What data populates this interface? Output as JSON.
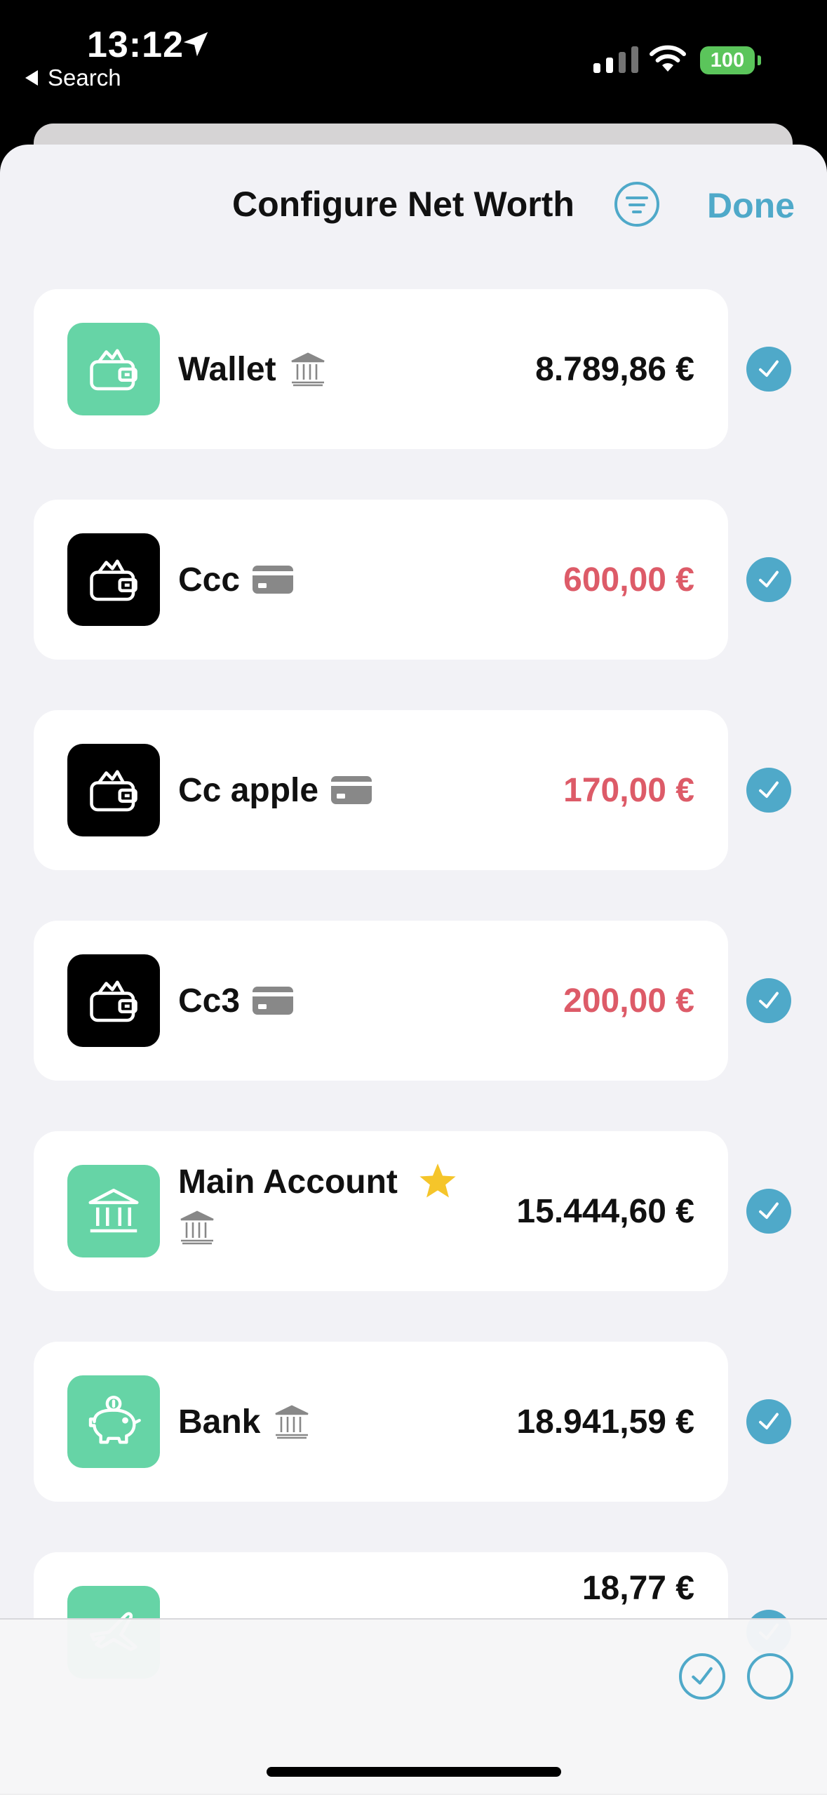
{
  "status_bar": {
    "time": "13:12",
    "back_label": "Search",
    "battery": "100"
  },
  "header": {
    "title": "Configure Net Worth",
    "done_label": "Done"
  },
  "colors": {
    "accent": "#4fa9c9",
    "negative": "#dd5b68",
    "icon_green": "#66d4a6",
    "star": "#f5c52a"
  },
  "accounts": [
    {
      "name": "Wallet",
      "type_icon": "bank-icon",
      "account_icon": "wallet-icon",
      "amount": "8.789,86 €",
      "negative": false,
      "selected": true
    },
    {
      "name": "Ccc",
      "type_icon": "credit-card-icon",
      "account_icon": "wallet-icon",
      "amount": "600,00 €",
      "negative": true,
      "selected": true
    },
    {
      "name": "Cc apple",
      "type_icon": "credit-card-icon",
      "account_icon": "wallet-icon",
      "amount": "170,00 €",
      "negative": true,
      "selected": true
    },
    {
      "name": "Cc3",
      "type_icon": "credit-card-icon",
      "account_icon": "wallet-icon",
      "amount": "200,00 €",
      "negative": true,
      "selected": true
    },
    {
      "name": "Main Account",
      "type_icon": "bank-icon",
      "account_icon": "bank-building-icon",
      "amount": "15.444,60 €",
      "negative": false,
      "favorite": true,
      "selected": true
    },
    {
      "name": "Bank",
      "type_icon": "bank-icon",
      "account_icon": "piggy-bank-icon",
      "amount": "18.941,59 €",
      "negative": false,
      "selected": true
    },
    {
      "name": "",
      "type_icon": "bank-icon",
      "account_icon": "airplane-icon",
      "amount": "18,77 €",
      "negative": false,
      "selected": true
    }
  ]
}
